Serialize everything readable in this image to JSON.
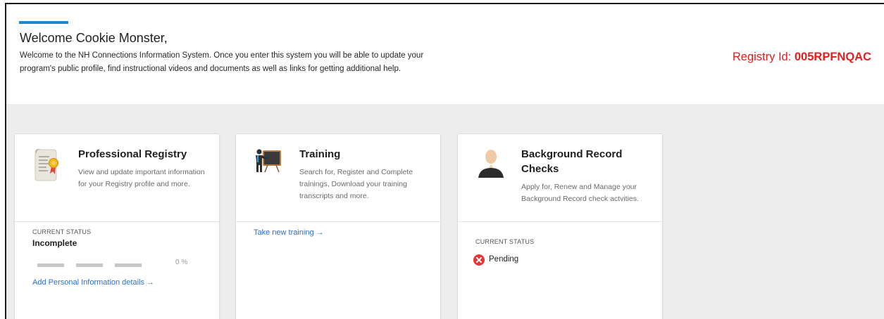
{
  "header": {
    "greeting": "Welcome Cookie Monster,",
    "intro_line1": "Welcome to the NH Connections Information System. Once you enter this system you will be able to update your",
    "intro_line2": "program's public profile, find instructional videos and documents as well as links for getting additional help.",
    "registry_label": "Registry Id: ",
    "registry_id": "005RPFNQAC"
  },
  "cards": [
    {
      "icon": "certificate-scroll-icon",
      "title": "Professional Registry",
      "description": "View and update important information for your Registry profile and more.",
      "status_label": "CURRENT STATUS",
      "status_value": "Incomplete",
      "progress_percent": 0,
      "progress_text": "0 %",
      "link": "Add Personal Information details →"
    },
    {
      "icon": "trainer-board-icon",
      "title": "Training",
      "description": "Search for, Register and Complete trainings, Download your training transcripts and more.",
      "link": "Take new training →"
    },
    {
      "icon": "person-silhouette-icon",
      "title": "Background Record Checks",
      "description": "Apply for, Renew and Manage your Background Record check actvities.",
      "status_label": "CURRENT STATUS",
      "status_value": "Pending"
    }
  ],
  "colors": {
    "accent": "#1e87d6",
    "registry": "#e02020",
    "link": "#2f6fc4",
    "pending": "#e53535",
    "background": "#ededee"
  }
}
